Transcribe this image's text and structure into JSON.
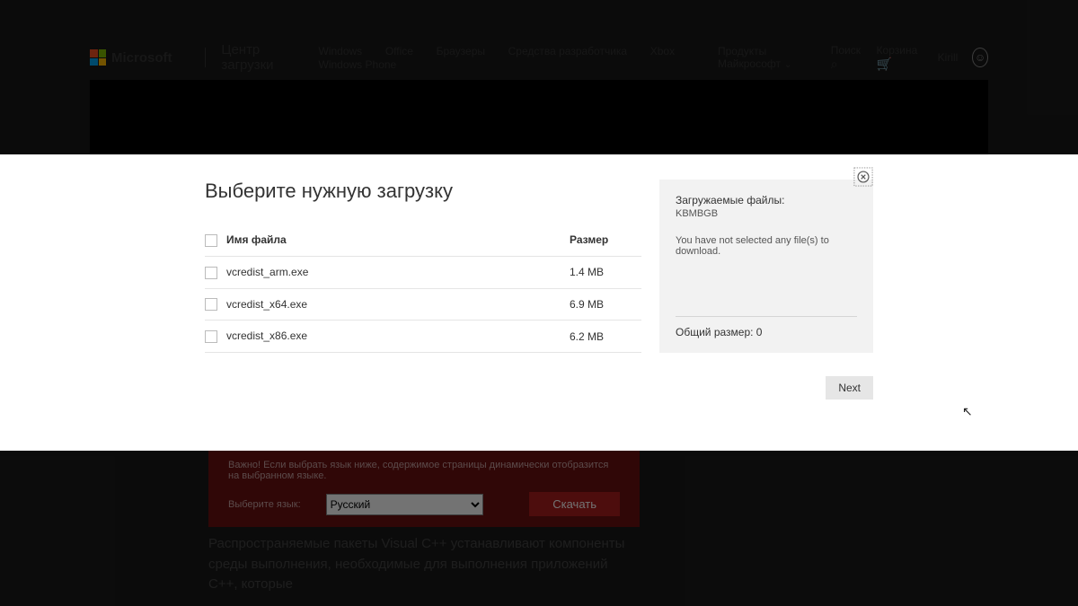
{
  "header": {
    "brand": "Microsoft",
    "section": "Центр загрузки",
    "nav": [
      "Windows",
      "Office",
      "Браузеры",
      "Средства разработчика",
      "Xbox",
      "Windows Phone"
    ],
    "products_label": "Продукты Майкрософт",
    "search_label": "Поиск",
    "cart_label": "Корзина",
    "user_name": "Kirill"
  },
  "lang_strip": {
    "note": "Важно! Если выбрать язык ниже, содержимое страницы динамически отобразится на выбранном языке.",
    "select_label": "Выберите язык:",
    "selected": "Русский",
    "download_btn": "Скачать"
  },
  "description": "Распространяемые пакеты Visual C++ устанавливают компоненты среды выполнения, необходимые для выполнения приложений C++, которые",
  "modal": {
    "title": "Выберите нужную загрузку",
    "col_name": "Имя файла",
    "col_size": "Размер",
    "files": [
      {
        "name": "vcredist_arm.exe",
        "size": "1.4 MB"
      },
      {
        "name": "vcredist_x64.exe",
        "size": "6.9 MB"
      },
      {
        "name": "vcredist_x86.exe",
        "size": "6.2 MB"
      }
    ],
    "side": {
      "title": "Загружаемые файлы:",
      "kb": "KBMBGB",
      "empty_msg": "You have not selected any file(s) to download.",
      "total_label": "Общий размер: 0"
    },
    "next_btn": "Next"
  }
}
